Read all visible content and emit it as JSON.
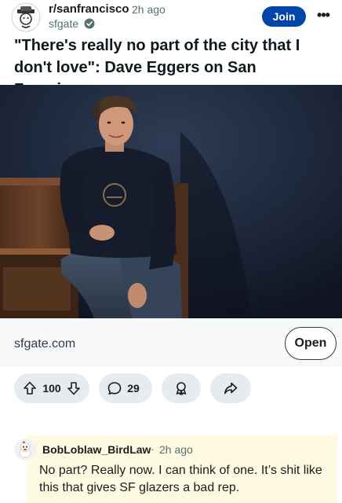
{
  "post": {
    "subreddit": "r/sanfrancisco",
    "time": "2h ago",
    "author": "sfgate",
    "join_label": "Join",
    "more_label": "•••",
    "title": "\"There's really no part of the city that I don't love\": Dave Eggers on San Francisco",
    "link_domain": "sfgate.com",
    "open_label": "Open",
    "upvotes": "100",
    "comments": "29"
  },
  "comment": {
    "author": "BobLoblaw_BirdLaw",
    "separator": "·",
    "time": "2h ago",
    "body": "No part? Really now. I can think of one. It’s shit like this that gives SF glazers a bad rep."
  },
  "colors": {
    "join_button": "#0045ac",
    "action_pill": "#e5ebee",
    "comment_highlight": "#fffbe3"
  },
  "icons": [
    "subreddit-avatar-icon",
    "verified-icon",
    "upvote-icon",
    "downvote-icon",
    "comment-icon",
    "award-icon",
    "share-icon",
    "user-avatar-icon"
  ]
}
